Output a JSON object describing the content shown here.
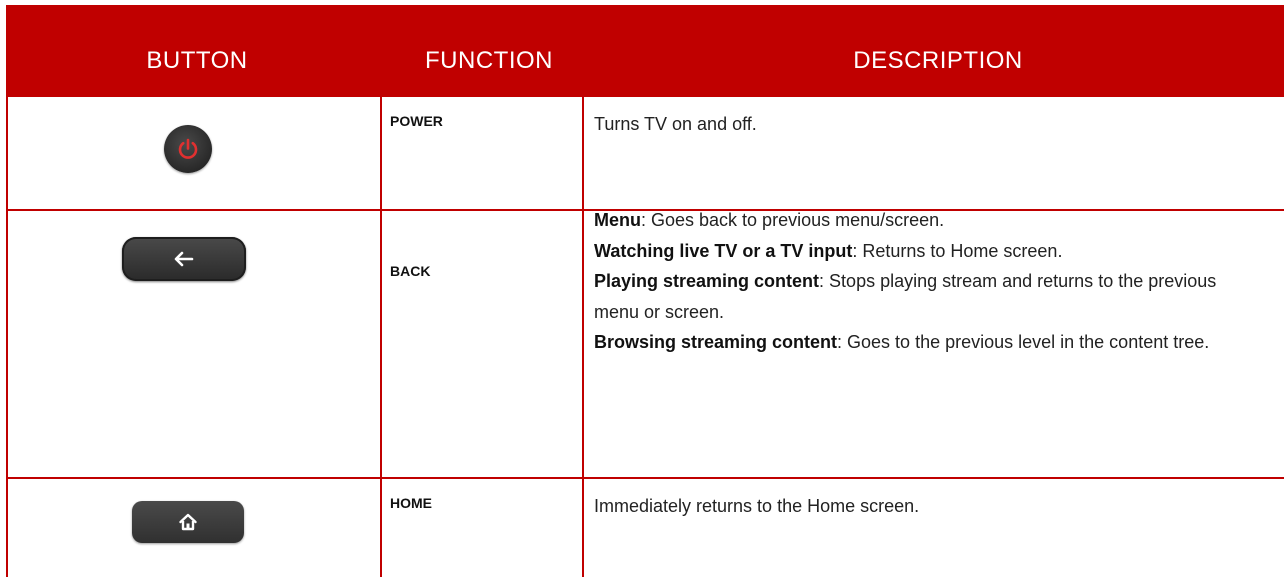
{
  "header": {
    "button_col": "BUTTON",
    "function_col": "FUNCTION",
    "description_col": "DESCRIPTION"
  },
  "colors": {
    "header_bg": "#c00000",
    "power_icon": "#e03030",
    "button_body": "#333333"
  },
  "rows": [
    {
      "icon": "power-icon",
      "function": "POWER",
      "description": [
        {
          "label": "",
          "text": "Turns TV on and off."
        }
      ]
    },
    {
      "icon": "back-arrow-icon",
      "function": "BACK",
      "description": [
        {
          "label": "Menu",
          "text": ": Goes back to previous menu/screen."
        },
        {
          "label": "Watching live TV or a TV input",
          "text": ": Returns to Home screen."
        },
        {
          "label": "Playing streaming content",
          "text": ": Stops playing stream and returns to the previous menu or screen."
        },
        {
          "label": "Browsing streaming content",
          "text": ": Goes to the previous level in the content tree."
        }
      ]
    },
    {
      "icon": "home-icon",
      "function": "HOME",
      "description": [
        {
          "label": "",
          "text": "Immediately returns to the Home screen."
        }
      ]
    }
  ]
}
